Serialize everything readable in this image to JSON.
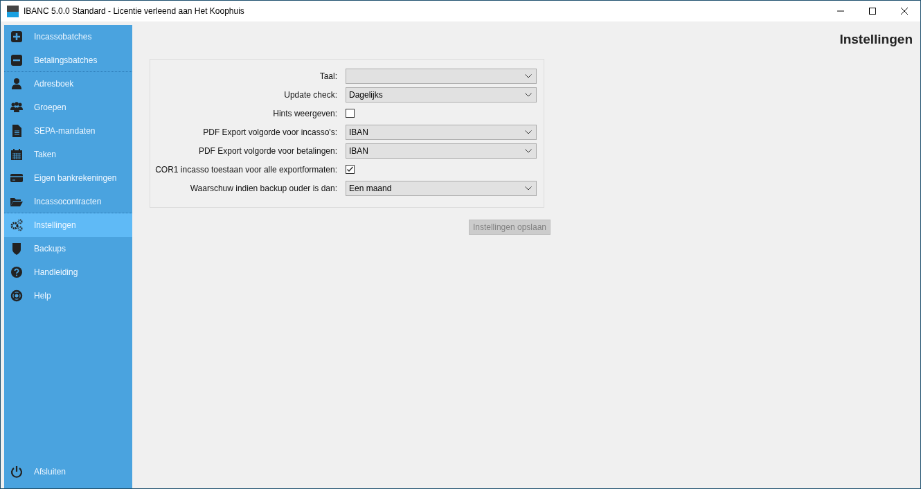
{
  "window": {
    "title": "IBANC 5.0.0 Standard - Licentie verleend aan Het Koophuis"
  },
  "sidebar": {
    "items": [
      {
        "label": "Incassobatches",
        "selected": false,
        "divider_after": false
      },
      {
        "label": "Betalingsbatches",
        "selected": false,
        "divider_after": true
      },
      {
        "label": "Adresboek",
        "selected": false,
        "divider_after": false
      },
      {
        "label": "Groepen",
        "selected": false,
        "divider_after": false
      },
      {
        "label": "SEPA-mandaten",
        "selected": false,
        "divider_after": false
      },
      {
        "label": "Taken",
        "selected": false,
        "divider_after": false
      },
      {
        "label": "Eigen bankrekeningen",
        "selected": false,
        "divider_after": false
      },
      {
        "label": "Incassocontracten",
        "selected": false,
        "divider_after": true
      },
      {
        "label": "Instellingen",
        "selected": true,
        "divider_after": false
      },
      {
        "label": "Backups",
        "selected": false,
        "divider_after": false
      },
      {
        "label": "Handleiding",
        "selected": false,
        "divider_after": false
      },
      {
        "label": "Help",
        "selected": false,
        "divider_after": false
      }
    ],
    "footer_item": {
      "label": "Afsluiten"
    }
  },
  "page": {
    "title": "Instellingen",
    "settings": [
      {
        "kind": "select",
        "label": "Taal:"
      },
      {
        "kind": "select",
        "label": "Update check:",
        "value": "Dagelijks"
      },
      {
        "kind": "checkbox",
        "label": "Hints weergeven:",
        "checked": false
      },
      {
        "kind": "select",
        "label": "PDF Export volgorde voor incasso's:",
        "value": "IBAN"
      },
      {
        "kind": "select",
        "label": "PDF Export volgorde voor betalingen:",
        "value": "IBAN"
      },
      {
        "kind": "checkbox",
        "label": "COR1 incasso toestaan voor alle exportformaten:",
        "checked": true
      },
      {
        "kind": "select",
        "label": "Waarschuw indien backup ouder is dan:",
        "value": "Een maand"
      }
    ],
    "save_button": {
      "label": "Instellingen opslaan",
      "disabled": true
    }
  }
}
